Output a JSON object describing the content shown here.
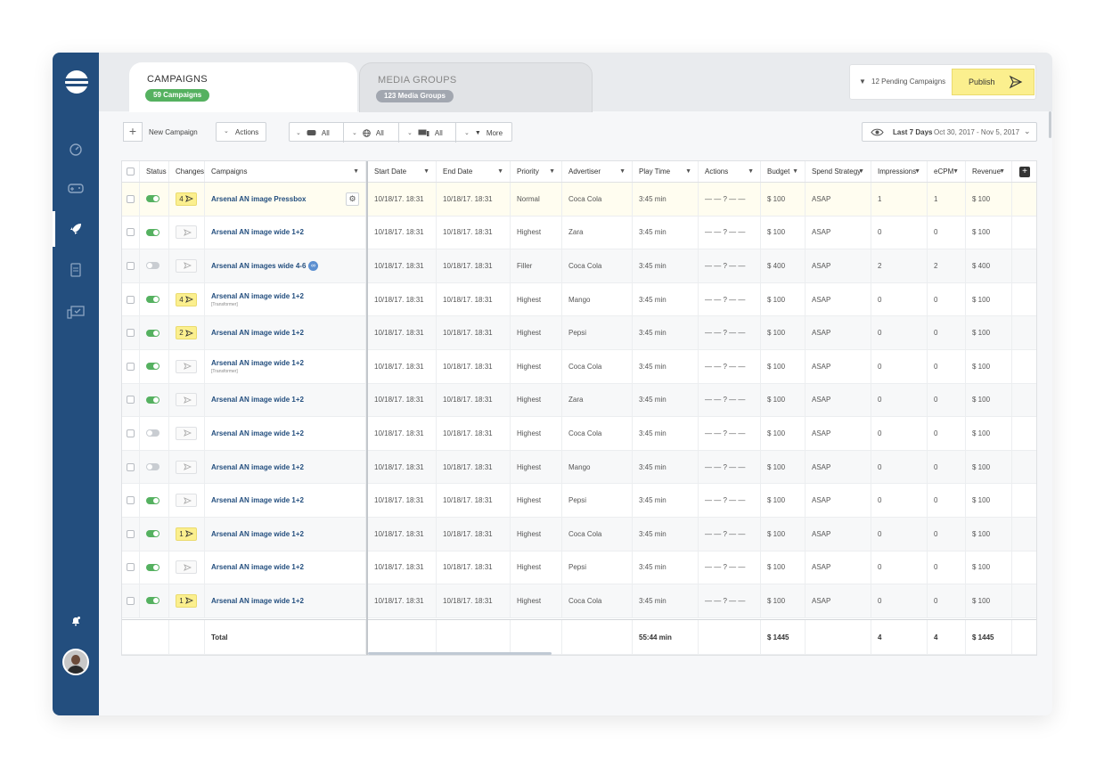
{
  "tabs": [
    {
      "label": "CAMPAIGNS",
      "badge": "59 Campaigns"
    },
    {
      "label": "MEDIA GROUPS",
      "badge": "123 Media Groups"
    }
  ],
  "pending": {
    "text": "12 Pending Campaigns",
    "publish_label": "Publish"
  },
  "toolbar": {
    "new_campaign": "New Campaign",
    "actions": "Actions",
    "filter_all_1": "All",
    "filter_all_2": "All",
    "filter_all_3": "All",
    "more": "More",
    "date_range_label": "Last 7 Days",
    "date_range": "Oct 30, 2017 - Nov 5, 2017"
  },
  "columns": [
    "Status",
    "Changes",
    "Campaigns",
    "Start Date",
    "End Date",
    "Priority",
    "Advertiser",
    "Play Time",
    "Actions",
    "Budget",
    "Spend Strategy",
    "Impressions",
    "eCPM",
    "Revenue"
  ],
  "rows": [
    {
      "status": "on",
      "changes": "4",
      "name": "Arsenal AN image Pressbox",
      "sub": "",
      "start": "10/18/17. 18:31",
      "end": "10/18/17. 18:31",
      "priority": "Normal",
      "advertiser": "Coca Cola",
      "play": "3:45 min",
      "actions": "— — ? — —",
      "budget": "$ 100",
      "strategy": "ASAP",
      "impressions": "1",
      "ecpm": "1",
      "revenue": "$ 100"
    },
    {
      "status": "on",
      "changes": "",
      "name": "Arsenal AN image wide 1+2",
      "sub": "",
      "start": "10/18/17. 18:31",
      "end": "10/18/17. 18:31",
      "priority": "Highest",
      "advertiser": "Zara",
      "play": "3:45 min",
      "actions": "— — ? — —",
      "budget": "$ 100",
      "strategy": "ASAP",
      "impressions": "0",
      "ecpm": "0",
      "revenue": "$ 100"
    },
    {
      "status": "off",
      "changes": "",
      "name": "Arsenal AN images wide 4-6",
      "sub": "",
      "start": "10/18/17. 18:31",
      "end": "10/18/17. 18:31",
      "priority": "Filler",
      "advertiser": "Coca Cola",
      "play": "3:45 min",
      "actions": "— — ? — —",
      "budget": "$ 400",
      "strategy": "ASAP",
      "impressions": "2",
      "ecpm": "2",
      "revenue": "$ 400"
    },
    {
      "status": "on",
      "changes": "4",
      "name": "Arsenal AN image wide 1+2",
      "sub": "[Transformer]",
      "start": "10/18/17. 18:31",
      "end": "10/18/17. 18:31",
      "priority": "Highest",
      "advertiser": "Mango",
      "play": "3:45 min",
      "actions": "— — ? — —",
      "budget": "$ 100",
      "strategy": "ASAP",
      "impressions": "0",
      "ecpm": "0",
      "revenue": "$ 100"
    },
    {
      "status": "on",
      "changes": "2",
      "name": "Arsenal AN image wide 1+2",
      "sub": "",
      "start": "10/18/17. 18:31",
      "end": "10/18/17. 18:31",
      "priority": "Highest",
      "advertiser": "Pepsi",
      "play": "3:45 min",
      "actions": "— — ? — —",
      "budget": "$ 100",
      "strategy": "ASAP",
      "impressions": "0",
      "ecpm": "0",
      "revenue": "$ 100"
    },
    {
      "status": "on",
      "changes": "",
      "name": "Arsenal AN image wide 1+2",
      "sub": "[Transformer]",
      "start": "10/18/17. 18:31",
      "end": "10/18/17. 18:31",
      "priority": "Highest",
      "advertiser": "Coca Cola",
      "play": "3:45 min",
      "actions": "— — ? — —",
      "budget": "$ 100",
      "strategy": "ASAP",
      "impressions": "0",
      "ecpm": "0",
      "revenue": "$ 100"
    },
    {
      "status": "on",
      "changes": "",
      "name": "Arsenal AN image wide 1+2",
      "sub": "",
      "start": "10/18/17. 18:31",
      "end": "10/18/17. 18:31",
      "priority": "Highest",
      "advertiser": "Zara",
      "play": "3:45 min",
      "actions": "— — ? — —",
      "budget": "$ 100",
      "strategy": "ASAP",
      "impressions": "0",
      "ecpm": "0",
      "revenue": "$ 100"
    },
    {
      "status": "off",
      "changes": "",
      "name": "Arsenal AN image wide 1+2",
      "sub": "",
      "start": "10/18/17. 18:31",
      "end": "10/18/17. 18:31",
      "priority": "Highest",
      "advertiser": "Coca Cola",
      "play": "3:45 min",
      "actions": "— — ? — —",
      "budget": "$ 100",
      "strategy": "ASAP",
      "impressions": "0",
      "ecpm": "0",
      "revenue": "$ 100"
    },
    {
      "status": "off",
      "changes": "",
      "name": "Arsenal AN image wide 1+2",
      "sub": "",
      "start": "10/18/17. 18:31",
      "end": "10/18/17. 18:31",
      "priority": "Highest",
      "advertiser": "Mango",
      "play": "3:45 min",
      "actions": "— — ? — —",
      "budget": "$ 100",
      "strategy": "ASAP",
      "impressions": "0",
      "ecpm": "0",
      "revenue": "$ 100"
    },
    {
      "status": "on",
      "changes": "",
      "name": "Arsenal AN image wide 1+2",
      "sub": "",
      "start": "10/18/17. 18:31",
      "end": "10/18/17. 18:31",
      "priority": "Highest",
      "advertiser": "Pepsi",
      "play": "3:45 min",
      "actions": "— — ? — —",
      "budget": "$ 100",
      "strategy": "ASAP",
      "impressions": "0",
      "ecpm": "0",
      "revenue": "$ 100"
    },
    {
      "status": "on",
      "changes": "1",
      "name": "Arsenal AN image wide 1+2",
      "sub": "",
      "start": "10/18/17. 18:31",
      "end": "10/18/17. 18:31",
      "priority": "Highest",
      "advertiser": "Coca Cola",
      "play": "3:45 min",
      "actions": "— — ? — —",
      "budget": "$ 100",
      "strategy": "ASAP",
      "impressions": "0",
      "ecpm": "0",
      "revenue": "$ 100"
    },
    {
      "status": "on",
      "changes": "",
      "name": "Arsenal AN image wide 1+2",
      "sub": "",
      "start": "10/18/17. 18:31",
      "end": "10/18/17. 18:31",
      "priority": "Highest",
      "advertiser": "Pepsi",
      "play": "3:45 min",
      "actions": "— — ? — —",
      "budget": "$ 100",
      "strategy": "ASAP",
      "impressions": "0",
      "ecpm": "0",
      "revenue": "$ 100"
    },
    {
      "status": "on",
      "changes": "1",
      "name": "Arsenal AN image wide 1+2",
      "sub": "",
      "start": "10/18/17. 18:31",
      "end": "10/18/17. 18:31",
      "priority": "Highest",
      "advertiser": "Coca Cola",
      "play": "3:45 min",
      "actions": "— — ? — —",
      "budget": "$ 100",
      "strategy": "ASAP",
      "impressions": "0",
      "ecpm": "0",
      "revenue": "$ 100"
    }
  ],
  "totals": {
    "label": "Total",
    "play": "55:44 min",
    "budget": "$ 1445",
    "impressions": "4",
    "ecpm": "4",
    "revenue": "$ 1445"
  },
  "colors": {
    "sidebar": "#234e7e",
    "accent_green": "#55b160",
    "highlight_yellow": "#fbef8e",
    "link_blue": "#234e7e"
  },
  "icons": [
    "logo-icon",
    "dashboard-icon",
    "gamepad-icon",
    "rocket-icon",
    "document-icon",
    "monitor-check-icon",
    "bell-icon",
    "send-icon",
    "gear-icon",
    "filter-icon",
    "eye-icon",
    "globe-icon",
    "screen-icon",
    "chevron-down-icon",
    "plus-icon"
  ]
}
